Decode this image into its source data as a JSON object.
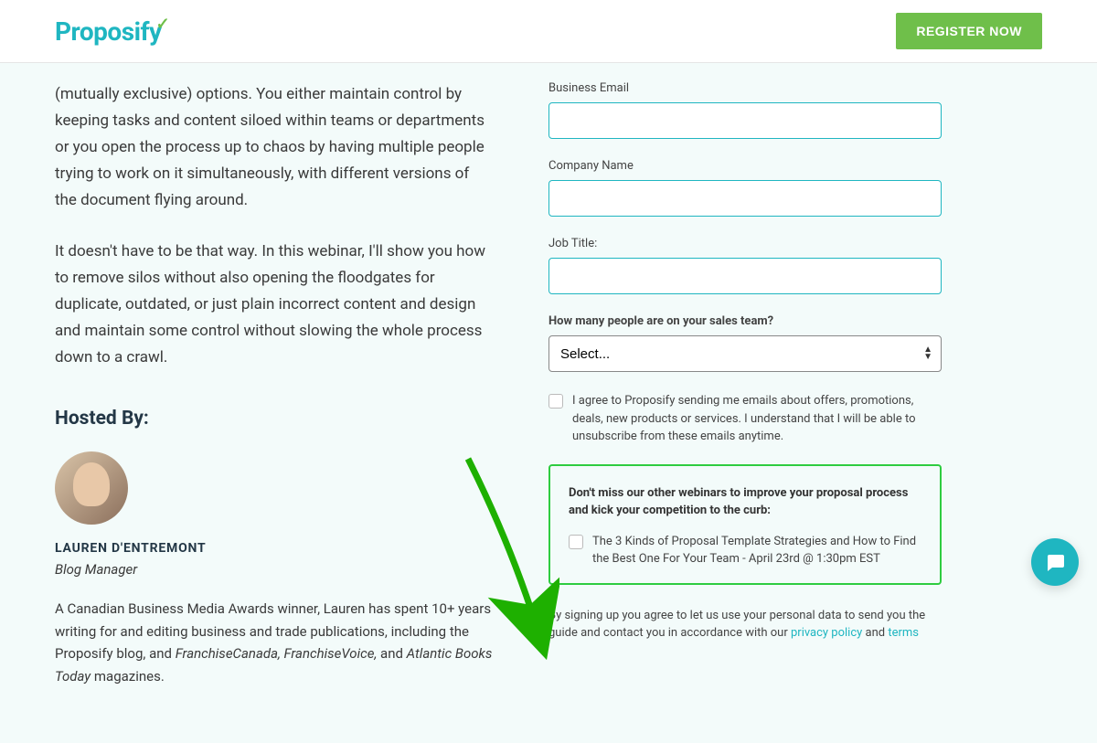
{
  "header": {
    "logo_text": "Proposify",
    "register_label": "REGISTER NOW"
  },
  "content": {
    "para1": "(mutually exclusive) options. You either maintain control by keeping tasks and content siloed within teams or departments or you open the process up to chaos by having multiple people trying to work on it simultaneously, with different versions of the document flying around.",
    "para2": "It doesn't have to be that way. In this webinar, I'll show you how to remove silos without also opening the floodgates for duplicate, outdated, or just plain incorrect content and design and maintain some control without slowing the whole process down to a crawl.",
    "hosted_by_label": "Hosted By:",
    "host_name": "LAUREN D'ENTREMONT",
    "host_role": "Blog Manager",
    "host_bio_1": "A Canadian Business Media Awards winner, Lauren has spent 10+ years writing for and editing business and trade publications, including the Proposify blog, and ",
    "host_bio_2": "FranchiseCanada, FranchiseVoice,",
    "host_bio_3": " and ",
    "host_bio_4": "Atlantic Books Today",
    "host_bio_5": " magazines."
  },
  "form": {
    "business_email_label": "Business Email",
    "company_name_label": "Company Name",
    "job_title_label": "Job Title:",
    "team_size_label": "How many people are on your sales team?",
    "team_size_placeholder": "Select...",
    "consent_text": "I agree to Proposify sending me emails about offers, promotions, deals, new products or services. I understand that I will be able to unsubscribe from these emails anytime.",
    "webinar_box_title": "Don't miss our other webinars to improve your proposal process and kick your competition to the curb:",
    "webinar_option_1": "The 3 Kinds of Proposal Template Strategies and How to Find the Best One For Your Team - April 23rd @ 1:30pm EST",
    "legal_1": "By signing up you agree to let us use your personal data to send you the guide and contact you in accordance with our ",
    "legal_privacy": "privacy policy",
    "legal_2": " and ",
    "legal_terms": "terms"
  },
  "colors": {
    "brand_teal": "#1fb6c1",
    "brand_green": "#6fbf4a",
    "highlight_green": "#2ecc40"
  }
}
